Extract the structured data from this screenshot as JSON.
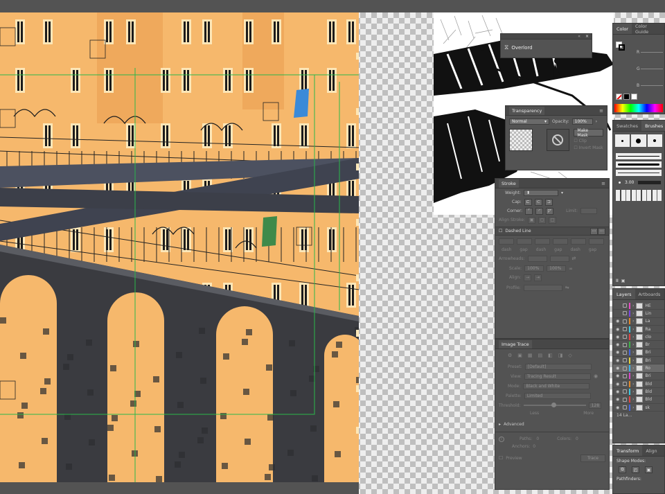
{
  "overlord_panel": {
    "title": "Overlord"
  },
  "transparency_panel": {
    "title": "Transparency",
    "blend_mode": "Normal",
    "opacity_label": "Opacity:",
    "opacity_value": "100%",
    "make_mask_label": "Make Mask",
    "clip_label": "Clip",
    "invert_mask_label": "Invert Mask"
  },
  "stroke_panel": {
    "title": "Stroke",
    "weight_label": "Weight:",
    "cap_label": "Cap:",
    "corner_label": "Corner:",
    "limit_label": "Limit:",
    "align_stroke_label": "Align Stroke:",
    "dashed_line_label": "Dashed Line",
    "dash_labels": [
      "dash",
      "gap",
      "dash",
      "gap",
      "dash",
      "gap"
    ],
    "arrowheads_label": "Arrowheads:",
    "scale_label": "Scale:",
    "scale_value_1": "100%",
    "scale_value_2": "100%",
    "align_label": "Align:",
    "profile_label": "Profile:"
  },
  "image_trace_panel": {
    "title": "Image Trace",
    "preset_label": "Preset:",
    "preset_value": "[Default]",
    "view_label": "View:",
    "view_value": "Tracing Result",
    "mode_label": "Mode:",
    "mode_value": "Black and White",
    "palette_label": "Palette:",
    "palette_value": "Limited",
    "threshold_label": "Threshold:",
    "threshold_value": "128",
    "threshold_less": "Less",
    "threshold_more": "More",
    "advanced_label": "Advanced",
    "paths_label": "Paths:",
    "paths_value": "0",
    "colors_label": "Colors:",
    "colors_value": "0",
    "anchors_label": "Anchors:",
    "anchors_value": "0",
    "preview_label": "Preview",
    "trace_label": "Trace"
  },
  "color_panel": {
    "tabs": [
      "Color",
      "Color Guide"
    ],
    "r_label": "R",
    "g_label": "G",
    "b_label": "B"
  },
  "brushes_panel": {
    "tabs": [
      "Swatches",
      "Brushes"
    ],
    "size_value": "3.00"
  },
  "layers_panel": {
    "tabs": [
      "Layers",
      "Artboards"
    ],
    "rows": [
      {
        "name": "HE",
        "color": "#e84cc4",
        "selected": false,
        "locked": false,
        "visible": false
      },
      {
        "name": "Lin",
        "color": "#7a44e0",
        "selected": false,
        "locked": false,
        "visible": false
      },
      {
        "name": "La",
        "color": "#e0882e",
        "selected": false,
        "locked": false,
        "visible": true
      },
      {
        "name": "Ra",
        "color": "#3ec8e0",
        "selected": false,
        "locked": false,
        "visible": true
      },
      {
        "name": "clo",
        "color": "#e04444",
        "selected": false,
        "locked": false,
        "visible": true
      },
      {
        "name": "Br",
        "color": "#3fb04a",
        "selected": false,
        "locked": false,
        "visible": true
      },
      {
        "name": "Bri",
        "color": "#4466e0",
        "selected": false,
        "locked": false,
        "visible": true
      },
      {
        "name": "Bri",
        "color": "#e0d23e",
        "selected": false,
        "locked": false,
        "visible": true
      },
      {
        "name": "Ro",
        "color": "#3ab4e8",
        "selected": true,
        "locked": false,
        "visible": true
      },
      {
        "name": "Bri",
        "color": "#d84ac8",
        "selected": false,
        "locked": false,
        "visible": true
      },
      {
        "name": "Bld",
        "color": "#e08a2e",
        "selected": false,
        "locked": false,
        "visible": true
      },
      {
        "name": "Bld",
        "color": "#3ec8e0",
        "selected": false,
        "locked": false,
        "visible": true
      },
      {
        "name": "Bld",
        "color": "#e04444",
        "selected": false,
        "locked": false,
        "visible": true
      },
      {
        "name": "sk",
        "color": "#4466e0",
        "selected": false,
        "locked": false,
        "visible": true
      }
    ],
    "count_label": "14 La..."
  },
  "transform_panel": {
    "tabs": [
      "Transform",
      "Align"
    ],
    "shape_modes_label": "Shape Modes:",
    "pathfinders_label": "Pathfinders:"
  },
  "colors": {
    "building": "#f6b86c",
    "building_dark": "#e89a4c",
    "bridge": "#3a3b40",
    "road": "#4c5160",
    "guide": "#29b84a",
    "panel_bg": "#535353"
  }
}
